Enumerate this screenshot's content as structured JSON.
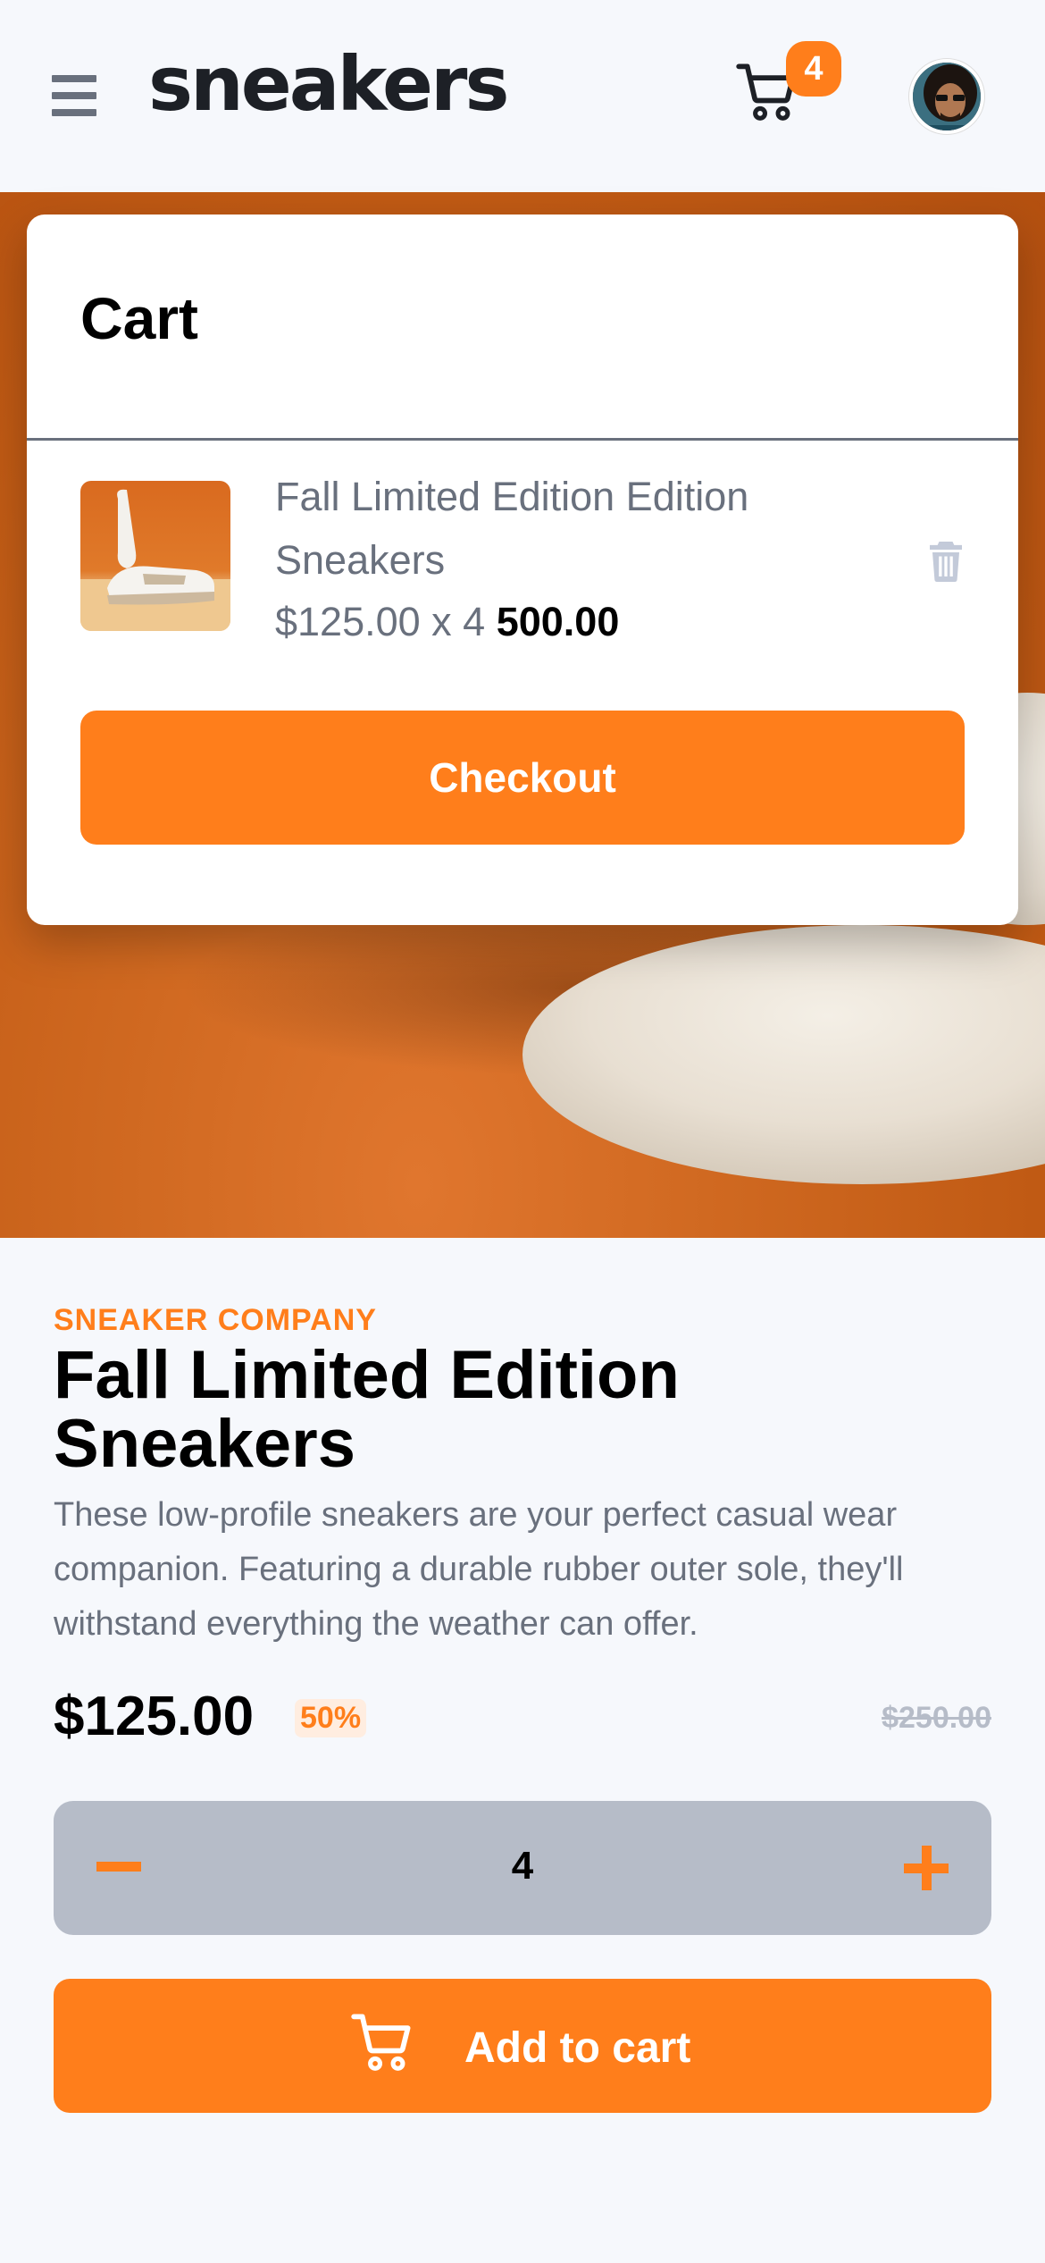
{
  "header": {
    "logo": "sneakers",
    "cart_count": "4",
    "icons": [
      "menu-icon",
      "cart-icon",
      "avatar"
    ]
  },
  "cart": {
    "title": "Cart",
    "item": {
      "name": "Fall Limited Edition Edition Sneakers",
      "unit_price_qty": "$125.00 x 4",
      "total": "500.00",
      "delete_icon": "trash-icon"
    },
    "checkout_label": "Checkout"
  },
  "product": {
    "company": "SNEAKER COMPANY",
    "title": "Fall Limited Edition Sneakers",
    "description": "These low-profile sneakers are your perfect casual wear companion. Featuring a durable rubber outer sole, they'll withstand everything the weather can offer.",
    "price": "$125.00",
    "discount": "50%",
    "old_price": "$250.00"
  },
  "quantity": {
    "value": "4",
    "minus_icon": "minus-icon",
    "plus_icon": "plus-icon"
  },
  "add_to_cart": {
    "label": "Add to cart",
    "icon": "cart-icon"
  },
  "colors": {
    "accent": "#ff7e1b",
    "text_dark": "#000000",
    "text_muted": "#69707d",
    "grey_light": "#b6bcc8",
    "background": "#f6f8fc"
  }
}
